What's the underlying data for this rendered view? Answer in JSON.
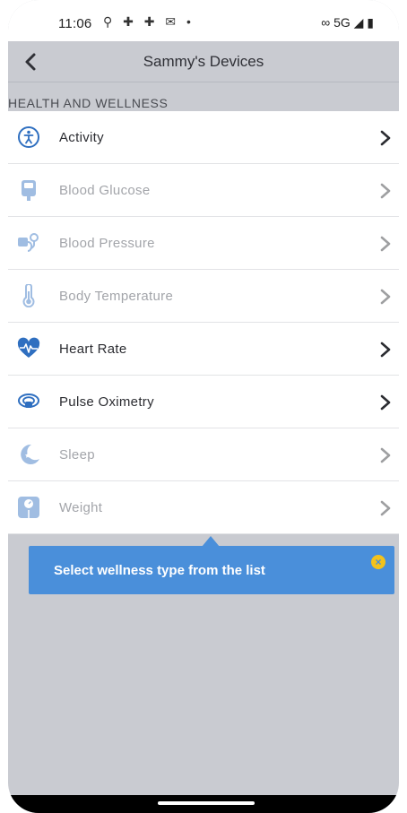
{
  "status_bar": {
    "time": "11:06",
    "left_icons": "⚲ ✚ ✚ ✉ •",
    "right": "∞ 5G ◢ ▮"
  },
  "header": {
    "title": "Sammy's Devices"
  },
  "section": {
    "label": "HEALTH AND WELLNESS"
  },
  "items": [
    {
      "label": "Activity",
      "icon": "activity-icon",
      "enabled": true
    },
    {
      "label": "Blood Glucose",
      "icon": "blood-glucose-icon",
      "enabled": false
    },
    {
      "label": "Blood Pressure",
      "icon": "blood-pressure-icon",
      "enabled": false
    },
    {
      "label": "Body Temperature",
      "icon": "thermometer-icon",
      "enabled": false
    },
    {
      "label": "Heart Rate",
      "icon": "heart-rate-icon",
      "enabled": true
    },
    {
      "label": "Pulse Oximetry",
      "icon": "pulse-oximetry-icon",
      "enabled": true
    },
    {
      "label": "Sleep",
      "icon": "sleep-moon-icon",
      "enabled": false
    },
    {
      "label": "Weight",
      "icon": "weight-scale-icon",
      "enabled": false
    }
  ],
  "tooltip": {
    "text": "Select wellness type from the list",
    "close": "×"
  },
  "colors": {
    "accent": "#4a8fda",
    "icon_blue": "#2f6fc0",
    "background": "#c9cbd1",
    "close_badge": "#f3c21c"
  }
}
